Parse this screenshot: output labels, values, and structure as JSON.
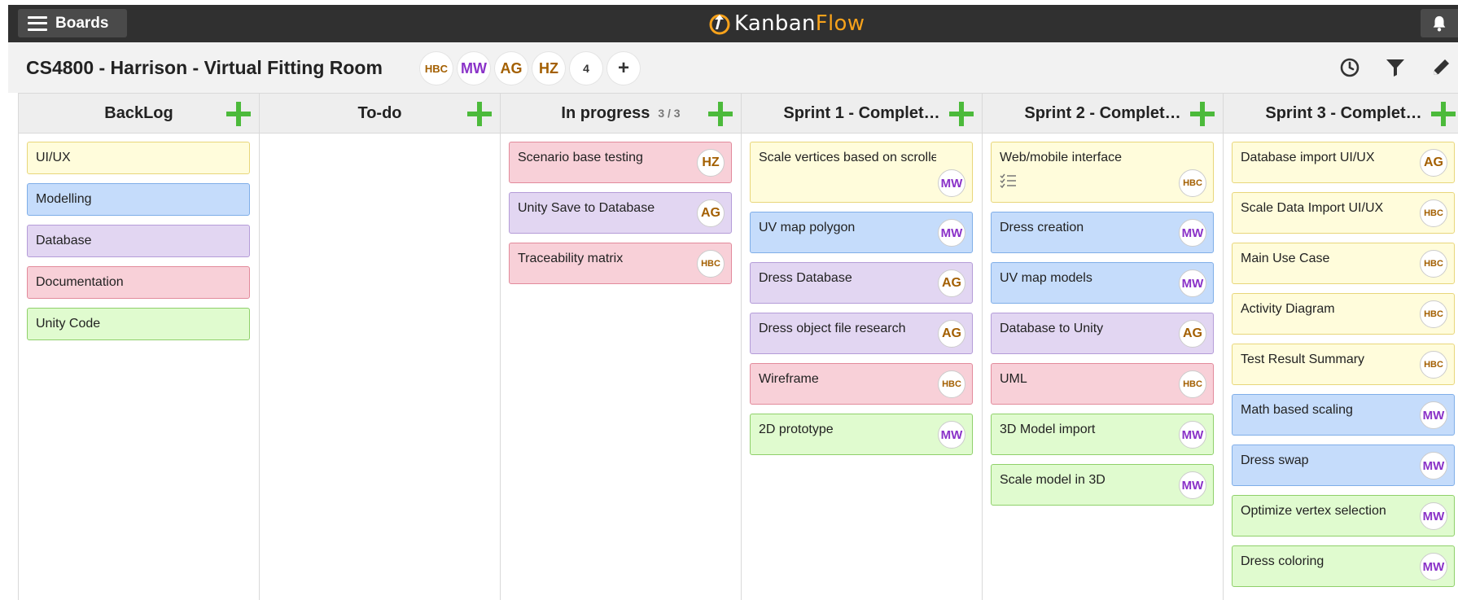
{
  "topbar": {
    "boards_label": "Boards",
    "logo_kanban": "Kanban",
    "logo_flow": "Flow",
    "logo_color": "#f7a21b"
  },
  "board": {
    "title": "CS4800 - Harrison - Virtual Fitting Room",
    "members": [
      "HBC",
      "MW",
      "AG",
      "HZ"
    ],
    "member_count": "4",
    "add_member": "+"
  },
  "columns": [
    {
      "title": "BackLog",
      "wip": ""
    },
    {
      "title": "To-do",
      "wip": ""
    },
    {
      "title": "In progress",
      "wip": "3 / 3"
    },
    {
      "title": "Sprint 1 - Complet…",
      "wip": ""
    },
    {
      "title": "Sprint 2 - Complet…",
      "wip": ""
    },
    {
      "title": "Sprint 3 - Complet…",
      "wip": ""
    }
  ],
  "cards": {
    "backlog": [
      {
        "label": "UI/UX",
        "color": "yellow"
      },
      {
        "label": "Modelling",
        "color": "blue"
      },
      {
        "label": "Database",
        "color": "purple"
      },
      {
        "label": "Documentation",
        "color": "red"
      },
      {
        "label": "Unity Code",
        "color": "green"
      }
    ],
    "in_progress": [
      {
        "label": "Scenario base testing",
        "color": "red",
        "avatar": "HZ"
      },
      {
        "label": "Unity Save to Database",
        "color": "purple",
        "avatar": "AG"
      },
      {
        "label": "Traceability matrix",
        "color": "red",
        "avatar": "HBC"
      }
    ],
    "sprint1": [
      {
        "label": "Scale vertices based on scroller",
        "color": "yellow",
        "avatar": "MW"
      },
      {
        "label": "UV map polygon",
        "color": "blue",
        "avatar": "MW"
      },
      {
        "label": "Dress Database",
        "color": "purple",
        "avatar": "AG"
      },
      {
        "label": "Dress object file research",
        "color": "purple",
        "avatar": "AG"
      },
      {
        "label": "Wireframe",
        "color": "red",
        "avatar": "HBC"
      },
      {
        "label": "2D prototype",
        "color": "green",
        "avatar": "MW"
      }
    ],
    "sprint2": [
      {
        "label": "Web/mobile interface",
        "color": "yellow",
        "avatar": "HBC",
        "icon": "checklist-icon"
      },
      {
        "label": "Dress creation",
        "color": "blue",
        "avatar": "MW"
      },
      {
        "label": "UV map models",
        "color": "blue",
        "avatar": "MW"
      },
      {
        "label": "Database to Unity",
        "color": "purple",
        "avatar": "AG"
      },
      {
        "label": "UML",
        "color": "red",
        "avatar": "HBC"
      },
      {
        "label": "3D Model import",
        "color": "green",
        "avatar": "MW"
      },
      {
        "label": "Scale model in 3D",
        "color": "green",
        "avatar": "MW"
      }
    ],
    "sprint3": [
      {
        "label": "Database import UI/UX",
        "color": "yellow",
        "avatar": "AG"
      },
      {
        "label": "Scale Data Import UI/UX",
        "color": "yellow",
        "avatar": "HBC"
      },
      {
        "label": "Main Use Case",
        "color": "yellow",
        "avatar": "HBC"
      },
      {
        "label": "Activity Diagram",
        "color": "yellow",
        "avatar": "HBC"
      },
      {
        "label": "Test Result Summary",
        "color": "yellow",
        "avatar": "HBC"
      },
      {
        "label": "Math based scaling",
        "color": "blue",
        "avatar": "MW"
      },
      {
        "label": "Dress swap",
        "color": "blue",
        "avatar": "MW"
      },
      {
        "label": "Optimize vertex selection",
        "color": "green",
        "avatar": "MW"
      },
      {
        "label": "Dress coloring",
        "color": "green",
        "avatar": "MW"
      }
    ]
  },
  "colors": {
    "topbar": "#303030",
    "add_green": "#4cba3b",
    "card_yellow": "#fffcdb",
    "card_blue": "#c5dcfb",
    "card_purple": "#e2d6f2",
    "card_red": "#f8d0d8",
    "card_green": "#e0fbcf"
  },
  "icons": [
    "menu-icon",
    "kanbanflow-logo-icon",
    "bell-icon",
    "history-clock-icon",
    "filter-icon",
    "edit-pencil-icon",
    "add-icon",
    "checklist-icon"
  ]
}
